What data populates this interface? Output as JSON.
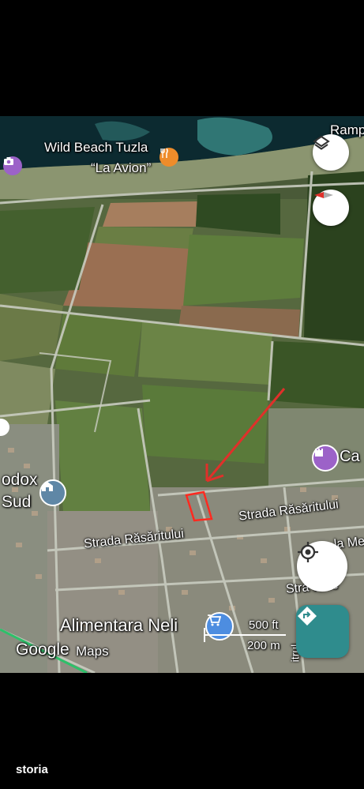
{
  "map": {
    "labels": {
      "wild_beach": "Wild Beach Tuzla",
      "la_avion": "“La Avion”",
      "ramp": "Ramp",
      "ca": "Ca",
      "odox": "odox",
      "sud": "Sud",
      "strada_rasaritului_1": "Strada Răsăritului",
      "strada_rasaritului_2": "Strada Răsăritului",
      "la_me": "la Me",
      "stra_stelle": "Stra  tellie",
      "alimentara": "Alimentara Neli",
      "trunc_street": "itrul"
    },
    "scale": {
      "imperial": "500 ft",
      "metric": "200 m"
    },
    "google_logo": "Google",
    "maps_text": "Maps",
    "icons": {
      "layers": "layers-icon",
      "compass": "compass-icon",
      "location": "my-location-icon",
      "directions": "directions-icon"
    },
    "colors": {
      "directions_bg": "#2f8c8d",
      "arrow_red": "#e0302a",
      "poi_purple": "#9c62c8",
      "poi_orange": "#ee8c2a",
      "poi_blue": "#4d8de0",
      "poi_slate": "#5f87a6"
    }
  },
  "footer": {
    "brand": "storia"
  }
}
